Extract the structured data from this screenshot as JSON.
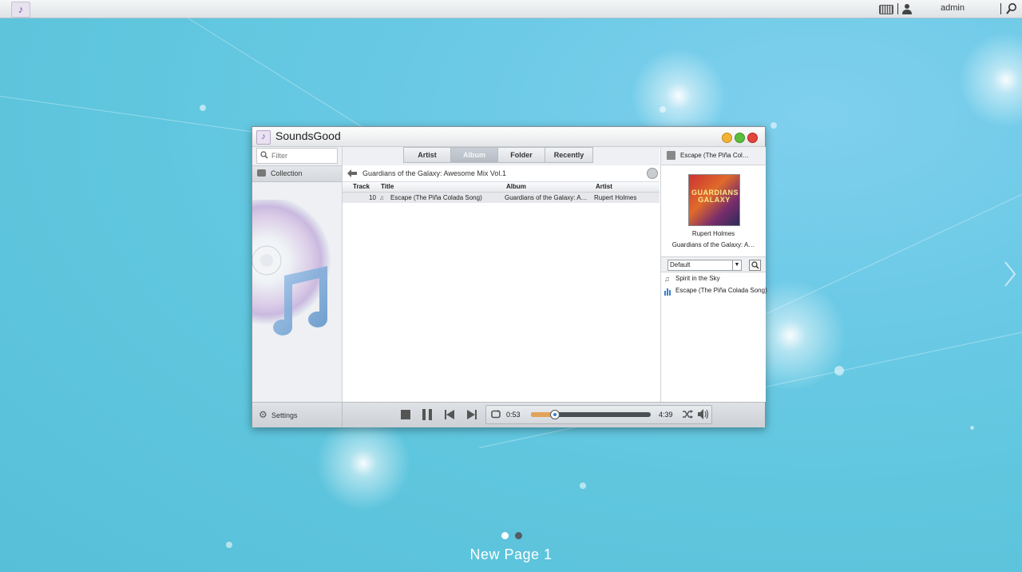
{
  "topbar": {
    "app_icon": "music-note-icon",
    "keyboard_icon": "keyboard-icon",
    "user_icon": "user-icon",
    "username": "admin",
    "search_icon": "search-icon"
  },
  "window": {
    "title": "SoundsGood",
    "controls": [
      "minimize",
      "maximize",
      "close"
    ],
    "colors": {
      "minimize": "#f2b233",
      "maximize": "#5cbd3a",
      "close": "#e2453c"
    }
  },
  "sidebar": {
    "filter_placeholder": "Filter",
    "collection_label": "Collection",
    "settings_label": "Settings"
  },
  "tabs": [
    {
      "label": "Artist",
      "active": false
    },
    {
      "label": "Album",
      "active": true
    },
    {
      "label": "Folder",
      "active": false
    },
    {
      "label": "Recently",
      "active": false
    }
  ],
  "breadcrumb": "Guardians of the Galaxy: Awesome Mix Vol.1",
  "table": {
    "columns": [
      "Track",
      "Title",
      "Album",
      "Artist"
    ],
    "rows": [
      {
        "track": "10",
        "title": "Escape (The Piña Colada Song)",
        "album": "Guardians of the Galaxy: Aw…",
        "artist": "Rupert Holmes"
      }
    ]
  },
  "now_playing": {
    "header_title": "Escape (The Piña Col…",
    "cover_text": "GUARDIANS GALAXY",
    "artist": "Rupert Holmes",
    "album": "Guardians of the Galaxy: A…"
  },
  "playlist": {
    "selected": "Default",
    "items": [
      {
        "title": "Spirit in the Sky",
        "icon": "music-note-icon"
      },
      {
        "title": "Escape (The Piña Colada Song)",
        "icon": "equalizer-icon"
      }
    ]
  },
  "player": {
    "elapsed": "0:53",
    "total": "4:39",
    "progress_fraction": 0.19,
    "accent": "#e2a35a"
  },
  "desktop": {
    "page_label": "New Page 1",
    "pages": 2,
    "current_page": 1
  }
}
